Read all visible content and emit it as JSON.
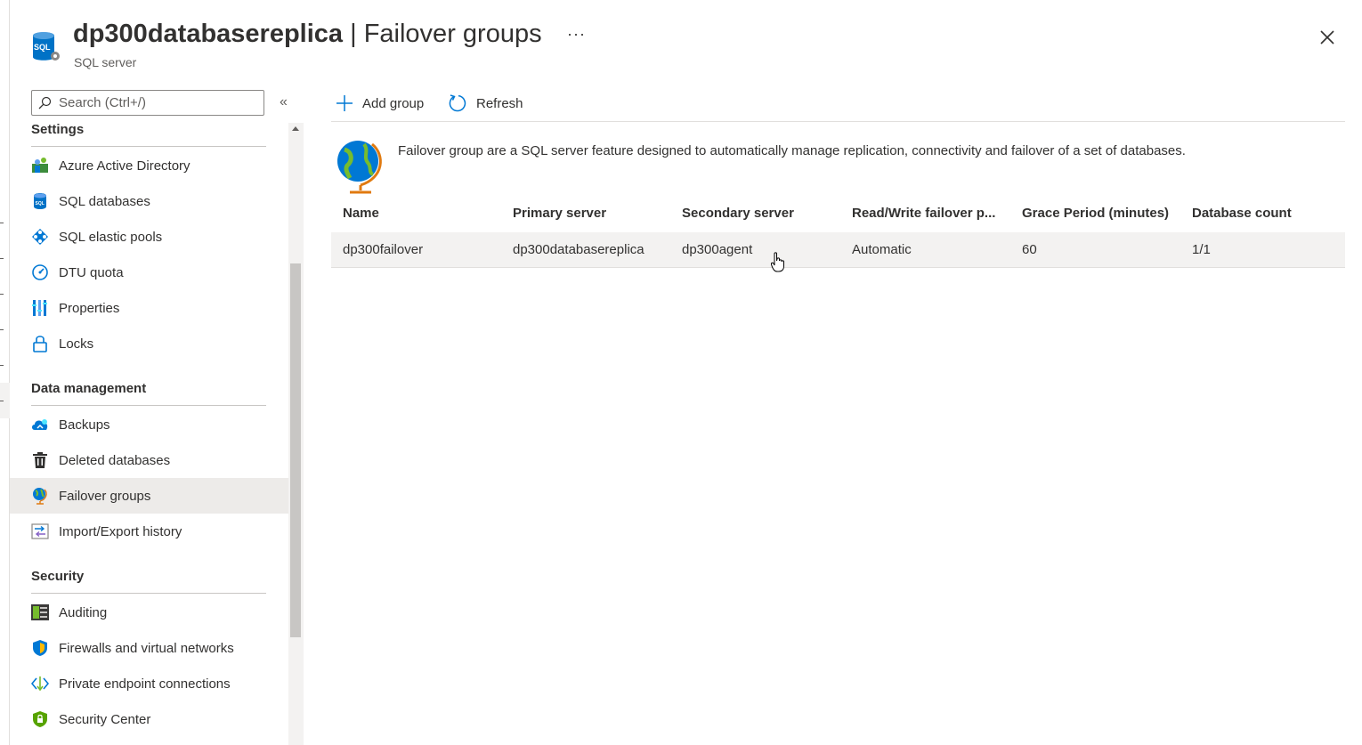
{
  "header": {
    "resource_name": "dp300databasereplica",
    "separator": " | ",
    "blade_title": "Failover groups",
    "subtitle": "SQL server",
    "more_label": "···",
    "resource_icon_text": "SQL"
  },
  "sidebar": {
    "search_placeholder": "Search (Ctrl+/)",
    "collapse_label": "«",
    "sections": [
      {
        "title": "Settings",
        "items": [
          {
            "label": "Azure Active Directory",
            "icon": "aad-icon"
          },
          {
            "label": "SQL databases",
            "icon": "sql-database-icon"
          },
          {
            "label": "SQL elastic pools",
            "icon": "elastic-pool-icon"
          },
          {
            "label": "DTU quota",
            "icon": "gauge-icon"
          },
          {
            "label": "Properties",
            "icon": "properties-icon"
          },
          {
            "label": "Locks",
            "icon": "lock-icon"
          }
        ]
      },
      {
        "title": "Data management",
        "items": [
          {
            "label": "Backups",
            "icon": "cloud-backup-icon"
          },
          {
            "label": "Deleted databases",
            "icon": "trash-icon"
          },
          {
            "label": "Failover groups",
            "icon": "globe-icon",
            "selected": true
          },
          {
            "label": "Import/Export history",
            "icon": "import-export-icon"
          }
        ]
      },
      {
        "title": "Security",
        "items": [
          {
            "label": "Auditing",
            "icon": "auditing-icon"
          },
          {
            "label": "Firewalls and virtual networks",
            "icon": "firewall-shield-icon"
          },
          {
            "label": "Private endpoint connections",
            "icon": "private-endpoint-icon"
          },
          {
            "label": "Security Center",
            "icon": "security-center-icon"
          }
        ]
      }
    ]
  },
  "toolbar": {
    "add_label": "Add group",
    "refresh_label": "Refresh"
  },
  "info": {
    "text": "Failover group are a SQL server feature designed to automatically manage replication, connectivity and failover of a set of databases."
  },
  "table": {
    "columns": [
      "Name",
      "Primary server",
      "Secondary server",
      "Read/Write failover p...",
      "Grace Period (minutes)",
      "Database count"
    ],
    "rows": [
      [
        "dp300failover",
        "dp300databasereplica",
        "dp300agent",
        "Automatic",
        "60",
        "1/1"
      ]
    ]
  },
  "colors": {
    "accent": "#0078d4",
    "selected_bg": "#edebe9",
    "row_bg": "#f3f2f1",
    "text": "#323130"
  }
}
